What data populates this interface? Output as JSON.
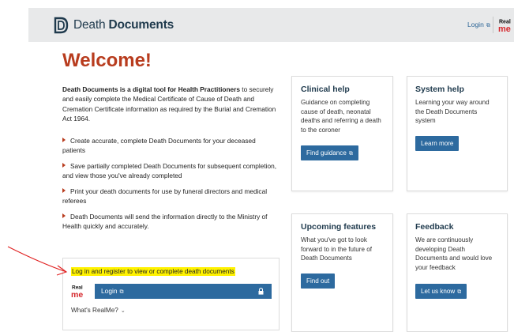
{
  "header": {
    "brand_light": "Death",
    "brand_bold": "Documents",
    "login_label": "Login",
    "realme_top": "Real",
    "realme_bottom": "me"
  },
  "main": {
    "title": "Welcome!",
    "intro_bold": "Death Documents is a digital tool for Health Practitioners",
    "intro_rest": " to securely and easily complete the Medical Certificate of Cause of Death and Cremation Certificate information as required by the Burial and Cremation Act 1964.",
    "bullets": [
      "Create accurate, complete Death Documents for your deceased patients",
      "Save partially completed Death Documents for subsequent completion, and view those you've already completed",
      "Print your death documents for use by funeral directors and medical referees",
      "Death Documents will send the information directly to the Ministry of Health quickly and accurately."
    ]
  },
  "cards": {
    "clinical": {
      "title": "Clinical help",
      "text": "Guidance on completing cause of death, neonatal deaths and referring a death to the coroner",
      "button": "Find guidance"
    },
    "system": {
      "title": "System help",
      "text": "Learning your way around the Death Documents system",
      "button": "Learn more"
    },
    "upcoming": {
      "title": "Upcoming features",
      "text": "What you've got to look forward to in the future of Death Documents",
      "button": "Find out"
    },
    "feedback": {
      "title": "Feedback",
      "text": "We are continuously developing Death Documents and would love your feedback",
      "button": "Let us know"
    }
  },
  "login_panel": {
    "prompt": "Log in and register to view or complete death documents",
    "login_button": "Login",
    "whats_realme": "What's RealMe?",
    "realme_top": "Real",
    "realme_bottom": "me"
  },
  "colors": {
    "accent_red": "#b83c1e",
    "button_blue": "#2d6a9f",
    "highlight_yellow": "#fff200",
    "annotation_red": "#e02020"
  },
  "icons": [
    "death-documents-logo-icon",
    "external-link-icon",
    "lock-icon",
    "chevron-down-icon",
    "bullet-arrow-icon",
    "realme-logo-icon",
    "annotation-arrow-icon"
  ]
}
